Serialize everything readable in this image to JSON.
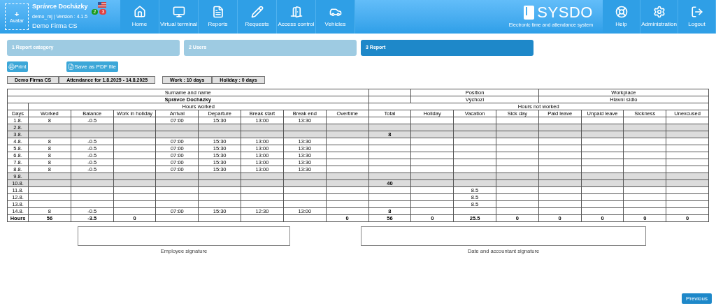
{
  "header": {
    "avatar_label": "Avatar",
    "avatar_plus": "+",
    "user_name": "Správce Docházky",
    "version": "demo_mj | Version : 4.1.5",
    "company": "Demo Firma CS",
    "badges": [
      {
        "text": "2",
        "color": "#1a9a1a"
      },
      {
        "text": "3",
        "color": "#e04040"
      }
    ],
    "nav": [
      {
        "label": "Home"
      },
      {
        "label": "Virtual terminal"
      },
      {
        "label": "Reports"
      },
      {
        "label": "Requests"
      },
      {
        "label": "Access control"
      },
      {
        "label": "Vehicles"
      }
    ],
    "logo": {
      "name": "SYSDO",
      "tagline": "Electronic time and attendance system"
    },
    "right_nav": [
      {
        "label": "Help"
      },
      {
        "label": "Administration"
      },
      {
        "label": "Logout"
      }
    ]
  },
  "steps": [
    {
      "label": "1 Report category",
      "selected": false
    },
    {
      "label": "2 Users",
      "selected": false
    },
    {
      "label": "3 Report",
      "selected": true
    }
  ],
  "actions": [
    {
      "label": "Print"
    },
    {
      "label": "Save as PDF file"
    }
  ],
  "info": [
    [
      "Demo Firma CS",
      "Attendance for 1.8.2025 - 14.8.2025"
    ],
    [
      "Work : 10 days",
      "Holiday : 0 days"
    ]
  ],
  "report": {
    "surname_label": "Surname and name",
    "name": "Správce Docházky",
    "position_label": "Position",
    "position": "Výchozí",
    "workplace_label": "Workplace",
    "workplace": "Hlavní sídlo",
    "hours_worked": "Hours worked",
    "hours_not_worked": "Hours not worked",
    "columns": [
      "Days",
      "Worked",
      "Balance",
      "Work in holiday",
      "Arrival",
      "Departure",
      "Break start",
      "Break end",
      "Overtime",
      "Total",
      "Holiday",
      "Vacation",
      "Sick day",
      "Paid leave",
      "Unpaid leave",
      "Sickness",
      "Unexcused"
    ],
    "rows": [
      {
        "weekend": false,
        "cells": {
          "0": "1.8.",
          "1": "8",
          "2": "-0.5",
          "4": "07:00",
          "5": "15:30",
          "6": "13:00",
          "7": "13:30"
        }
      },
      {
        "weekend": true,
        "cells": {
          "0": "2.8."
        }
      },
      {
        "weekend": true,
        "cells": {
          "0": "3.8.",
          "9": "8"
        }
      },
      {
        "weekend": false,
        "cells": {
          "0": "4.8.",
          "1": "8",
          "2": "-0.5",
          "4": "07:00",
          "5": "15:30",
          "6": "13:00",
          "7": "13:30"
        }
      },
      {
        "weekend": false,
        "cells": {
          "0": "5.8.",
          "1": "8",
          "2": "-0.5",
          "4": "07:00",
          "5": "15:30",
          "6": "13:00",
          "7": "13:30"
        }
      },
      {
        "weekend": false,
        "cells": {
          "0": "6.8.",
          "1": "8",
          "2": "-0.5",
          "4": "07:00",
          "5": "15:30",
          "6": "13:00",
          "7": "13:30"
        }
      },
      {
        "weekend": false,
        "cells": {
          "0": "7.8.",
          "1": "8",
          "2": "-0.5",
          "4": "07:00",
          "5": "15:30",
          "6": "13:00",
          "7": "13:30"
        }
      },
      {
        "weekend": false,
        "cells": {
          "0": "8.8.",
          "1": "8",
          "2": "-0.5",
          "4": "07:00",
          "5": "15:30",
          "6": "13:00",
          "7": "13:30"
        }
      },
      {
        "weekend": true,
        "cells": {
          "0": "9.8."
        }
      },
      {
        "weekend": true,
        "cells": {
          "0": "10.8.",
          "9": "40"
        }
      },
      {
        "weekend": false,
        "cells": {
          "0": "11.8.",
          "11": "8.5"
        }
      },
      {
        "weekend": false,
        "cells": {
          "0": "12.8.",
          "11": "8.5"
        }
      },
      {
        "weekend": false,
        "cells": {
          "0": "13.8.",
          "11": "8.5"
        }
      },
      {
        "weekend": false,
        "cells": {
          "0": "14.8.",
          "1": "8",
          "2": "-0.5",
          "4": "07:00",
          "5": "15:30",
          "6": "12:30",
          "7": "13:00",
          "9": "8"
        }
      }
    ],
    "totals": {
      "0": "Hours",
      "1": "56",
      "2": "-3.5",
      "3": "0",
      "8": "0",
      "9": "56",
      "10": "0",
      "11": "25.5",
      "12": "0",
      "13": "0",
      "14": "0",
      "15": "0",
      "16": "0"
    }
  },
  "signatures": [
    "Employee signature",
    "Date and accountant signature"
  ],
  "previous": "Previous"
}
